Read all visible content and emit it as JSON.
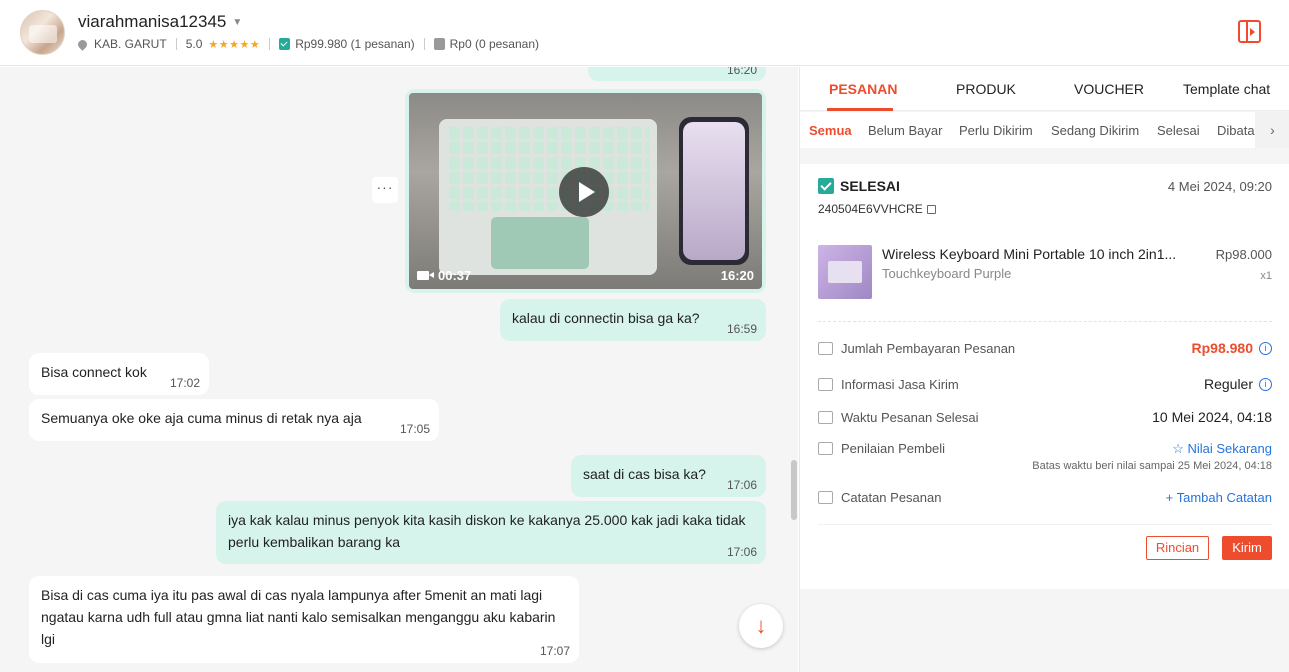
{
  "header": {
    "username": "viarahmanisa12345",
    "location": "KAB. GARUT",
    "rating": "5.0",
    "stars": "★★★★★",
    "completed_orders": "Rp99.980 (1 pesanan)",
    "cancelled_orders": "Rp0 (0 pesanan)"
  },
  "chat": {
    "top_partial_time": "16:20",
    "video": {
      "duration": "00:37",
      "time": "16:20"
    },
    "more_label": "···",
    "messages": [
      {
        "dir": "out",
        "text": "kalau di connectin bisa ga ka?",
        "time": "16:59"
      },
      {
        "dir": "in",
        "text": "Bisa connect kok",
        "time": "17:02"
      },
      {
        "dir": "in",
        "text": "Semuanya oke oke aja cuma minus di retak nya aja",
        "time": "17:05"
      },
      {
        "dir": "out",
        "text": "saat di cas bisa ka?",
        "time": "17:06"
      },
      {
        "dir": "out",
        "text": "iya kak kalau minus penyok kita kasih diskon ke kakanya 25.000 kak jadi kaka tidak perlu kembalikan barang ka",
        "time": "17:06"
      },
      {
        "dir": "in",
        "text": "Bisa di cas cuma iya itu pas awal di cas nyala lampunya after 5menit an mati lagi ngatau karna udh full atau gmna liat nanti kalo semisalkan menganggu aku kabarin lgi",
        "time": "17:07"
      }
    ],
    "scroll_down_icon": "↓"
  },
  "panel": {
    "tabs": [
      "PESANAN",
      "PRODUK",
      "VOUCHER",
      "Template chat"
    ],
    "subtabs": [
      "Semua",
      "Belum Bayar",
      "Perlu Dikirim",
      "Sedang Dikirim",
      "Selesai",
      "Dibata"
    ],
    "subtab_arrow": "›",
    "order": {
      "status": "SELESAI",
      "date": "4 Mei 2024, 09:20",
      "order_id": "240504E6VVHCRE",
      "product_name": "Wireless Keyboard Mini Portable 10 inch 2in1...",
      "variant": "Touchkeyboard Purple",
      "price": "Rp98.000",
      "qty": "x1",
      "payment_label": "Jumlah Pembayaran Pesanan",
      "payment_value": "Rp98.980",
      "shipping_label": "Informasi Jasa Kirim",
      "shipping_value": "Reguler",
      "completed_label": "Waktu Pesanan Selesai",
      "completed_value": "10 Mei 2024, 04:18",
      "review_label": "Penilaian Pembeli",
      "review_action": "☆ Nilai Sekarang",
      "review_deadline": "Batas waktu beri nilai sampai 25 Mei 2024, 04:18",
      "notes_label": "Catatan Pesanan",
      "notes_action": "+ Tambah Catatan",
      "detail_button": "Rincian",
      "send_button": "Kirim"
    }
  },
  "colors": {
    "accent": "#ee4d2d",
    "bubble_out": "#d6f4ec",
    "link": "#2673dd",
    "success": "#26aa99"
  }
}
